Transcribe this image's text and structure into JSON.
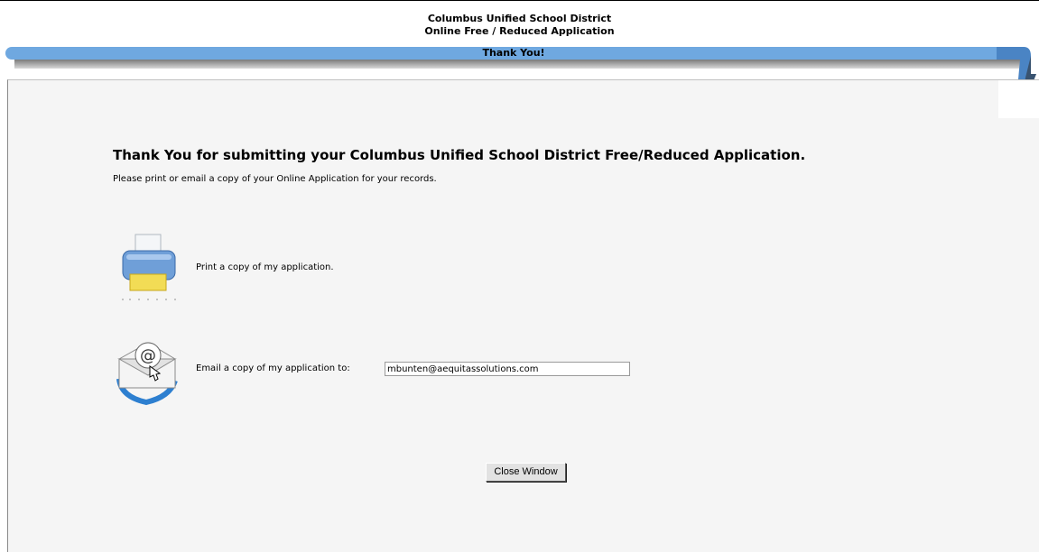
{
  "header": {
    "district": "Columbus Unified School District",
    "application": "Online Free / Reduced Application"
  },
  "banner": {
    "title": "Thank You!"
  },
  "main": {
    "title": "Thank You for submitting your Columbus Unified School District Free/Reduced Application.",
    "subtitle": "Please print or email a copy of your Online Application for your records."
  },
  "print": {
    "label": "Print a copy of my application.",
    "icon": "printer-icon"
  },
  "email": {
    "label": "Email a copy of my application to:",
    "value": "mbunten@aequitassolutions.com",
    "icon": "email-icon"
  },
  "close_button": {
    "label": "Close Window"
  },
  "colors": {
    "banner": "#6fa8e0",
    "panel_bg": "#f5f5f5",
    "arrow": "#4a84c4"
  }
}
